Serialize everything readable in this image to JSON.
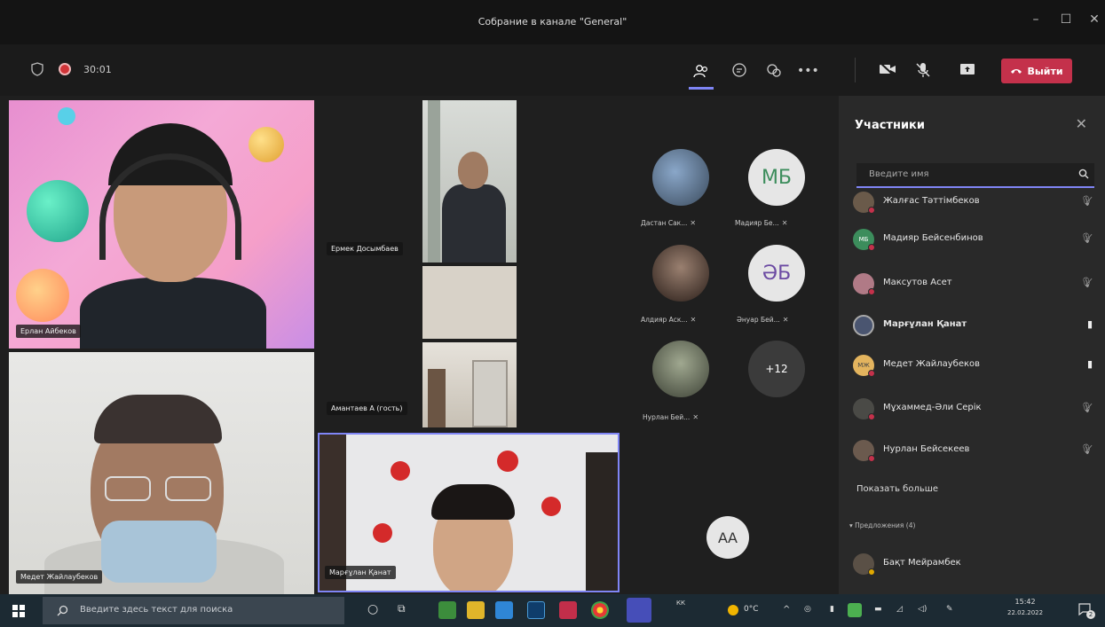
{
  "window": {
    "title": "Собрание в канале \"General\"",
    "minimize": "–",
    "maximize": "☐",
    "close": "✕"
  },
  "toolbar": {
    "timer": "30:01",
    "leave_label": "Выйти",
    "icons": [
      "shield-icon",
      "record-icon",
      "people-icon",
      "chat-icon",
      "reactions-icon",
      "more-icon",
      "camera-off-icon",
      "mic-off-icon",
      "share-icon",
      "phone-icon"
    ]
  },
  "stage": {
    "tiles": [
      {
        "name": "Ерлан Айбеков"
      },
      {
        "name": "Медет Жайлаубеков"
      },
      {
        "name": "Ермек Досымбаев"
      },
      {
        "name": "Амантаев А (гость)"
      },
      {
        "name": "Марғұлан Қанат"
      }
    ],
    "avatars": [
      {
        "label": "Дастан Сак...",
        "initials": ""
      },
      {
        "label": "Мадияр Бе...",
        "initials": "МБ"
      },
      {
        "label": "Алдияр Аск...",
        "initials": ""
      },
      {
        "label": "Әнуар Бей...",
        "initials": "ӘБ"
      },
      {
        "label": "Нурлан Бей...",
        "initials": ""
      },
      {
        "label": "",
        "initials": "+12"
      }
    ],
    "bottom_avatar": "АА"
  },
  "panel": {
    "title": "Участники",
    "search_placeholder": "Введите имя",
    "participants": [
      {
        "name": "Жалғас Тәттімбеков",
        "mic": "muted"
      },
      {
        "name": "Мадияр Бейсенбинов",
        "mic": "muted"
      },
      {
        "name": "Максутов Асет",
        "mic": "muted"
      },
      {
        "name": "Марғұлан Қанат",
        "mic": "on"
      },
      {
        "name": "Медет Жайлаубеков",
        "mic": "on"
      },
      {
        "name": "Мұхаммед-Әли Серік",
        "mic": "muted"
      },
      {
        "name": "Нурлан Бейсекеев",
        "mic": "muted"
      }
    ],
    "show_more": "Показать больше",
    "suggestions_label": "Предложения (4)",
    "suggested": [
      {
        "name": "Бақт Мейрамбек"
      }
    ],
    "initials": {
      "mb": "МБ",
      "mzh": "МЖ"
    }
  },
  "taskbar": {
    "search_placeholder": "Введите здесь текст для поиска",
    "weather": "0°C",
    "lang": "КК",
    "time": "15:42",
    "date": "22.02.2022",
    "notifications": "2"
  },
  "colors": {
    "accent": "#7f85f5",
    "leave": "#c4314b",
    "panel_bg": "#292929",
    "stage_bg": "#1f1f1f"
  }
}
